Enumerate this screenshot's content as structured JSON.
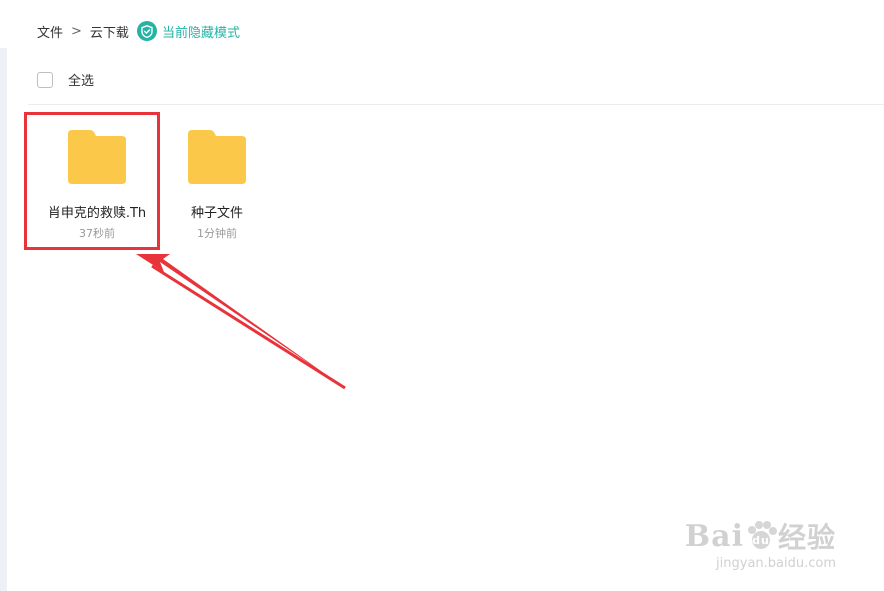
{
  "breadcrumb": {
    "items": [
      "文件",
      "云下载"
    ],
    "separator": ">",
    "mode_label": "当前隐藏模式"
  },
  "toolbar": {
    "select_all_label": "全选"
  },
  "files": [
    {
      "name": "肖申克的救赎.Th",
      "time": "37秒前",
      "type": "folder"
    },
    {
      "name": "种子文件",
      "time": "1分钟前",
      "type": "folder"
    }
  ],
  "colors": {
    "accent": "#26b3a6",
    "folder": "#fcc84a",
    "highlight": "#e8333a"
  },
  "watermark": {
    "brand_text": "Bai",
    "brand_text_2": "du",
    "brand_cn": "经验",
    "url": "jingyan.baidu.com"
  }
}
